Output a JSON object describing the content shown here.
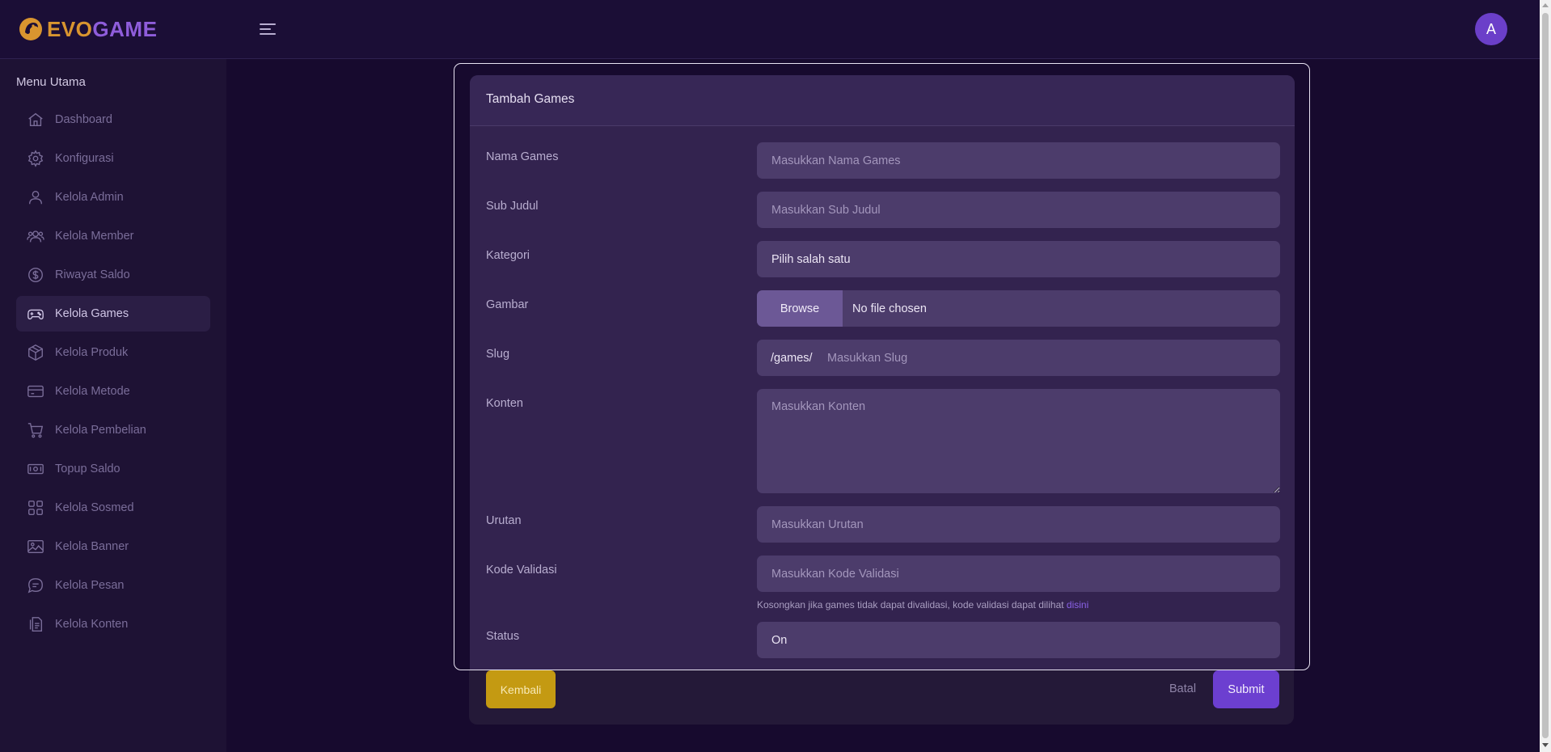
{
  "brand": {
    "name_part1": "EVO",
    "name_part2": "GAME"
  },
  "header": {
    "avatar_initial": "A"
  },
  "sidebar": {
    "title": "Menu Utama",
    "items": [
      {
        "label": "Dashboard",
        "icon": "home-icon"
      },
      {
        "label": "Konfigurasi",
        "icon": "gear-icon"
      },
      {
        "label": "Kelola Admin",
        "icon": "user-icon"
      },
      {
        "label": "Kelola Member",
        "icon": "users-icon"
      },
      {
        "label": "Riwayat Saldo",
        "icon": "dollar-icon"
      },
      {
        "label": "Kelola Games",
        "icon": "gamepad-icon",
        "active": true
      },
      {
        "label": "Kelola Produk",
        "icon": "box-icon"
      },
      {
        "label": "Kelola Metode",
        "icon": "card-icon"
      },
      {
        "label": "Kelola Pembelian",
        "icon": "cart-icon"
      },
      {
        "label": "Topup Saldo",
        "icon": "money-icon"
      },
      {
        "label": "Kelola Sosmed",
        "icon": "grid-icon"
      },
      {
        "label": "Kelola Banner",
        "icon": "image-icon"
      },
      {
        "label": "Kelola Pesan",
        "icon": "chat-icon"
      },
      {
        "label": "Kelola Konten",
        "icon": "document-icon"
      }
    ]
  },
  "form": {
    "title": "Tambah Games",
    "nama": {
      "label": "Nama Games",
      "placeholder": "Masukkan Nama Games"
    },
    "subjudul": {
      "label": "Sub Judul",
      "placeholder": "Masukkan Sub Judul"
    },
    "kategori": {
      "label": "Kategori",
      "value": "Pilih salah satu"
    },
    "gambar": {
      "label": "Gambar",
      "browse": "Browse",
      "file_text": "No file chosen"
    },
    "slug": {
      "label": "Slug",
      "prefix": "/games/",
      "placeholder": "Masukkan Slug"
    },
    "konten": {
      "label": "Konten",
      "placeholder": "Masukkan Konten"
    },
    "urutan": {
      "label": "Urutan",
      "placeholder": "Masukkan Urutan"
    },
    "kode": {
      "label": "Kode Validasi",
      "placeholder": "Masukkan Kode Validasi",
      "hint": "Kosongkan jika games tidak dapat divalidasi, kode validasi dapat dilihat ",
      "hint_link": "disini"
    },
    "status": {
      "label": "Status",
      "value": "On"
    }
  },
  "actions": {
    "back": "Kembali",
    "cancel": "Batal",
    "submit": "Submit"
  },
  "colors": {
    "accent": "#6c3fd0",
    "back_button": "#c49a12",
    "background": "#170a2e"
  }
}
